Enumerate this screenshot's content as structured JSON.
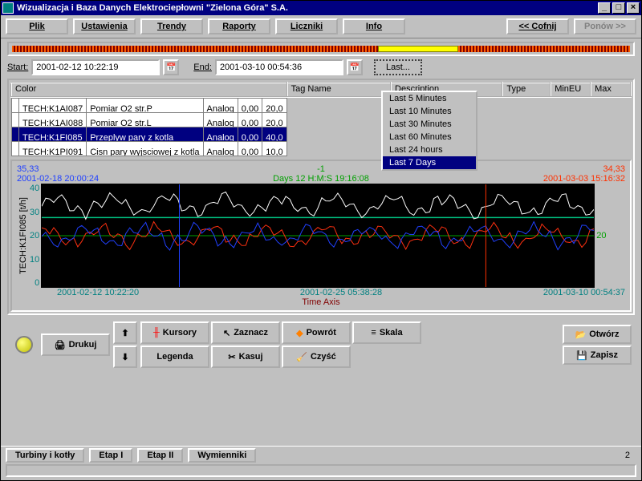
{
  "window": {
    "title": "Wizualizacja i Baza Danych Elektrociepłowni \"Zielona Góra\" S.A."
  },
  "menu": {
    "plik": "Plik",
    "ustawienia": "Ustawienia",
    "trendy": "Trendy",
    "raporty": "Raporty",
    "liczniki": "Liczniki",
    "info": "Info",
    "cofnij": "<<  Cofnij",
    "ponow": "Ponów  >>"
  },
  "dates": {
    "start_lbl": "Start:",
    "end_lbl": "End:",
    "start": "2001-02-12  10:22:19",
    "end": "2001-03-10  00:54:36",
    "last_btn": "Last..."
  },
  "last_menu": {
    "items": [
      "Last 5 Minutes",
      "Last 10 Minutes",
      "Last 30 Minutes",
      "Last 60 Minutes",
      "Last 24 hours",
      "Last 7 Days"
    ],
    "selected": 5
  },
  "grid": {
    "headers": {
      "color": "Color",
      "tag": "Tag Name",
      "desc": "Description",
      "type": "Type",
      "min": "MinEU",
      "max": "Max"
    },
    "rows": [
      {
        "color": "#1030ff",
        "tag": "TECH:K1AI087",
        "desc": "Pomiar O2 str.P",
        "type": "Analog",
        "min": "0,00",
        "max": "20,0"
      },
      {
        "color": "#ff3010",
        "tag": "TECH:K1AI088",
        "desc": "Pomiar O2 str.L",
        "type": "Analog",
        "min": "0,00",
        "max": "20,0"
      },
      {
        "color": "#802000",
        "tag": "TECH:K1FI085",
        "desc": "Przeplyw pary z kotla",
        "type": "Analog",
        "min": "0,00",
        "max": "40,0",
        "selected": true
      },
      {
        "color": "#008080",
        "tag": "TECH:K1PI091",
        "desc": "Cisn pary wyjsciowej z kotla",
        "type": "Analog",
        "min": "0,00",
        "max": "10,0"
      }
    ]
  },
  "chart": {
    "top_left_val": "35,33",
    "top_left_ts": "2001-02-18 20:00:24",
    "top_mid_val": "-1",
    "top_mid_ts": "Days 12  H:M:S  19:16:08",
    "top_right_val": "34,33",
    "top_right_ts": "2001-03-03 15:16:32",
    "y_label": "TECH:K1FI085 [t/h]",
    "y_ticks": [
      "40",
      "30",
      "20",
      "10",
      "0"
    ],
    "right_tick": "20",
    "x_left": "2001-02-12 10:22:20",
    "x_mid": "2001-02-25 05:38:28",
    "x_right": "2001-03-10 00:54:37",
    "x_axis": "Time Axis"
  },
  "chart_data": {
    "type": "line",
    "x_range": [
      "2001-02-12 10:22:20",
      "2001-03-10 00:54:37"
    ],
    "ylim": [
      0,
      40
    ],
    "series": [
      {
        "name": "TECH:K1AI087",
        "color": "#1030ff",
        "approx_mean": 20,
        "approx_min": 14,
        "approx_max": 27
      },
      {
        "name": "TECH:K1AI088",
        "color": "#ff3010",
        "approx_mean": 20,
        "approx_min": 14,
        "approx_max": 27
      },
      {
        "name": "TECH:K1FI085",
        "color": "#ffffff",
        "approx_mean": 32,
        "approx_min": 20,
        "approx_max": 39
      },
      {
        "name": "TECH:K1PI091",
        "color": "#00c080",
        "approx_mean": 27,
        "approx_min": 26,
        "approx_max": 28
      }
    ],
    "cursors": [
      {
        "x": "2001-02-18 20:00:24",
        "color": "#2040ff"
      },
      {
        "x": "2001-03-03 15:16:32",
        "color": "#ff3000"
      }
    ],
    "hline": {
      "y": 20,
      "color": "#00a000"
    }
  },
  "toolbar": {
    "drukuj": "Drukuj",
    "kursory": "Kursory",
    "zaznacz": "Zaznacz",
    "powrot": "Powrót",
    "skala": "Skala",
    "legenda": "Legenda",
    "kasuj": "Kasuj",
    "czysc": "Czyść",
    "otworz": "Otwórz",
    "zapisz": "Zapisz"
  },
  "status": {
    "turbiny": "Turbiny i kotły",
    "etap1": "Etap I",
    "etap2": "Etap II",
    "wymienniki": "Wymienniki",
    "num": "2"
  }
}
